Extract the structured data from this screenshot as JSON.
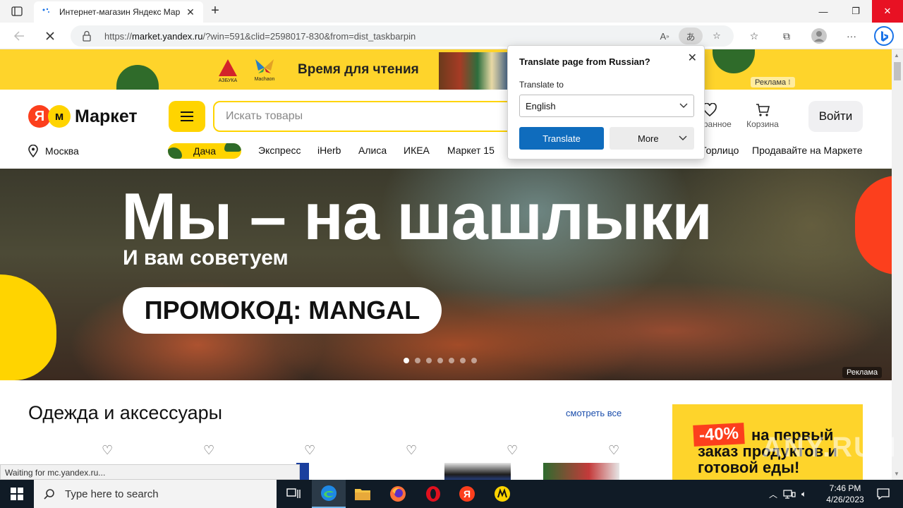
{
  "browser": {
    "tab_title": "Интернет-магазин Яндекс Мар",
    "url_prefix": "https://",
    "url_domain": "market.yandex.ru",
    "url_rest": "/?win=591&clid=2598017-830&from=dist_taskbarpin"
  },
  "ad_banner": {
    "text": "Время для чтения",
    "logo1": "АЗБУКА",
    "logo2": "Machaon",
    "label": "Реклама"
  },
  "header": {
    "logo_ya": "Я",
    "logo_text": "Маркет",
    "search_placeholder": "Искать товары",
    "favorites_label": "Избранное",
    "cart_label": "Корзина",
    "login_label": "Войти"
  },
  "nav": {
    "location": "Москва",
    "links": [
      "Дача",
      "Экспресс",
      "iHerb",
      "Алиса",
      "ИКЕА",
      "Маркет 15",
      "Горлицо",
      "Продавайте на Маркете"
    ]
  },
  "hero": {
    "title": "Мы – на шашлыки",
    "subtitle": "И вам советуем",
    "promo": "ПРОМОКОД: MANGAL",
    "ad_label": "Реклама",
    "slides_total": 7,
    "active_slide": 1
  },
  "section": {
    "title": "Одежда и аксессуары",
    "see_all": "смотреть все"
  },
  "promo_card": {
    "badge": "-40%",
    "text": "на первый заказ продуктов и готовой еды!"
  },
  "translate_popup": {
    "title": "Translate page from Russian?",
    "translate_to_label": "Translate to",
    "language": "English",
    "translate_button": "Translate",
    "more_button": "More"
  },
  "status_text": "Waiting for mc.yandex.ru...",
  "watermark": "ANY.RUN",
  "taskbar": {
    "search_placeholder": "Type here to search",
    "time": "7:46 PM",
    "date": "4/26/2023"
  }
}
